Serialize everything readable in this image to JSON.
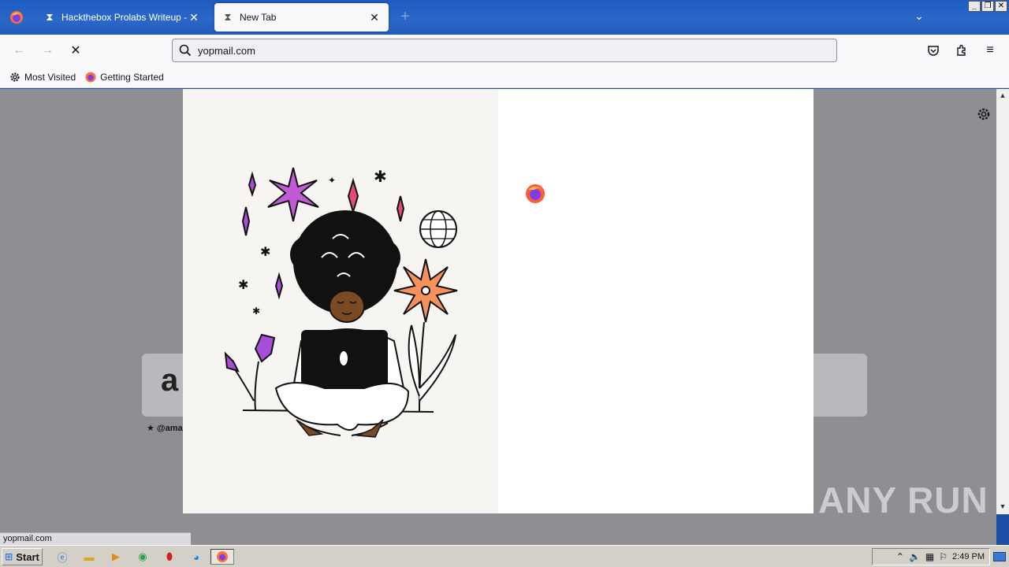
{
  "browser": {
    "tabs": [
      {
        "title": "Hackthebox Prolabs Writeup - HTB",
        "active": false
      },
      {
        "title": "New Tab",
        "active": true
      }
    ],
    "url": "yopmail.com",
    "bookmarks": [
      {
        "label": "Most Visited",
        "icon": "gear-icon"
      },
      {
        "label": "Getting Started",
        "icon": "firefox-icon"
      }
    ]
  },
  "newtab": {
    "top_site_label": "★ @ama"
  },
  "status_bar": {
    "url": "yopmail.com"
  },
  "watermark": "ANY RUN",
  "taskbar": {
    "start_label": "Start",
    "clock": "2:49 PM"
  },
  "colors": {
    "titlebar": "#2a67c8",
    "toolbar": "#f9f9fb",
    "page_overlay": "#8e8e93",
    "modal_left": "#f7f5f2"
  }
}
